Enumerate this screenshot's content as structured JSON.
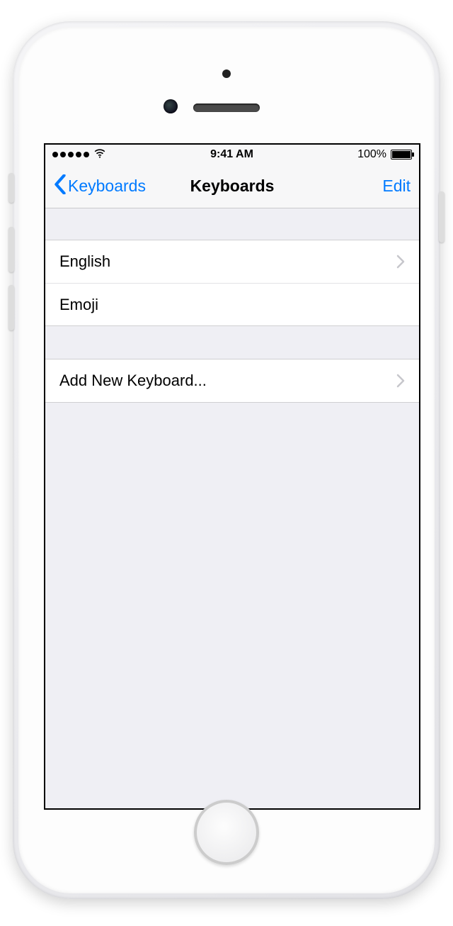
{
  "status": {
    "time": "9:41 AM",
    "battery_percent": "100%"
  },
  "nav": {
    "back_label": "Keyboards",
    "title": "Keyboards",
    "edit_label": "Edit"
  },
  "keyboards": [
    {
      "label": "English",
      "has_chevron": true
    },
    {
      "label": "Emoji",
      "has_chevron": false
    }
  ],
  "add_label": "Add New Keyboard..."
}
